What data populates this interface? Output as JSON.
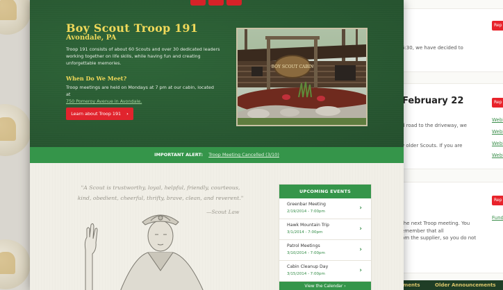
{
  "hero": {
    "title": "Boy Scout Troop 191",
    "subtitle": "Avondale, PA",
    "description": "Troop 191 consists of about 60 Scouts and over 30 dedicated leaders working together on life skills, while having fun and creating unforgettable memories.",
    "meet_heading": "When Do We Meet?",
    "meet_text": "Troop meetings are held on Mondays at 7 pm at our cabin, located at",
    "meet_address": "750 Pomeroy Avenue in Avondale.",
    "learn_button": "Learn about Troop 191",
    "learn_chevron": "›"
  },
  "alert": {
    "label": "IMPORTANT ALERT:",
    "link": "Troop Meeting Cancelled (3/10)"
  },
  "quote": {
    "text": "\"A Scout is trustworthy, loyal, helpful, friendly, courteous, kind, obedient, cheerful, thrifty, brave, clean, and reverent.\"",
    "cite": "—Scout Law"
  },
  "events": {
    "heading": "UPCOMING EVENTS",
    "items": [
      {
        "title": "Greenbar Meeting",
        "date": "2/19/2014 - 7:00pm"
      },
      {
        "title": "Hawk Mountain Trip",
        "date": "3/1/2014 - 7:00pm"
      },
      {
        "title": "Patrol Meetings",
        "date": "3/10/2014 - 7:00pm"
      },
      {
        "title": "Cabin Cleanup Day",
        "date": "3/15/2014 - 7:00pm"
      }
    ],
    "chevron": "›",
    "footer": "View the Calendar ›"
  },
  "photo": {
    "sign_text": "BOY SCOUT CABIN"
  },
  "right_page": {
    "title1": "l February 22",
    "snippets": [
      "6:30, we have decided to",
      "d road to the driveway, we",
      "y older Scouts. If you are",
      "the next Troop meeting. You",
      "emember that all",
      "om the supplier, so you do not"
    ],
    "reply_labels": [
      "Rep",
      "Rep",
      "Rep"
    ],
    "links": [
      "Webl",
      "Webl",
      "Webl",
      "Webl",
      "Fund"
    ],
    "footer_left": "ments",
    "footer_right": "Older Announcements"
  },
  "colors": {
    "hero_green": "#2a5a33",
    "accent_green": "#35954a",
    "gold": "#f0d95a",
    "red": "#e1242d"
  }
}
